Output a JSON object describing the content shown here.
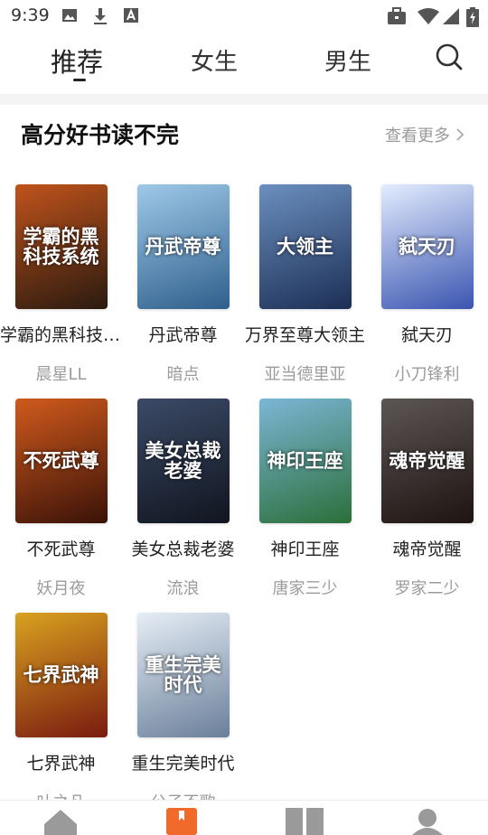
{
  "status": {
    "time": "9:39"
  },
  "tabs": [
    {
      "label": "推荐"
    },
    {
      "label": "女生"
    },
    {
      "label": "男生"
    }
  ],
  "section": {
    "title": "高分好书读不完",
    "more": "查看更多"
  },
  "books": [
    {
      "title": "学霸的黑科技系统",
      "author": "晨星LL",
      "cover_text": "学霸的黑科技系统",
      "colors": [
        "#c0531b",
        "#2a1a10"
      ]
    },
    {
      "title": "丹武帝尊",
      "author": "暗点",
      "cover_text": "丹武帝尊",
      "colors": [
        "#9ec9e8",
        "#2f5f8c"
      ]
    },
    {
      "title": "万界至尊大领主",
      "author": "亚当德里亚",
      "cover_text": "大领主",
      "colors": [
        "#6b8fbf",
        "#1c2f55"
      ]
    },
    {
      "title": "弑天刃",
      "author": "小刀锋利",
      "cover_text": "弑天刃",
      "colors": [
        "#e3ecff",
        "#3a55b0"
      ]
    },
    {
      "title": "不死武尊",
      "author": "妖月夜",
      "cover_text": "不死武尊",
      "colors": [
        "#d05a1c",
        "#3a1208"
      ]
    },
    {
      "title": "美女总裁老婆",
      "author": "流浪",
      "cover_text": "美女总裁老婆",
      "colors": [
        "#3b4a66",
        "#10151f"
      ]
    },
    {
      "title": "神印王座",
      "author": "唐家三少",
      "cover_text": "神印王座",
      "colors": [
        "#7bb6d6",
        "#2b6f3a"
      ]
    },
    {
      "title": "魂帝觉醒",
      "author": "罗家二少",
      "cover_text": "魂帝觉醒",
      "colors": [
        "#5c5655",
        "#1e1412"
      ]
    },
    {
      "title": "七界武神",
      "author": "叶之凡",
      "cover_text": "七界武神",
      "colors": [
        "#d9a21f",
        "#7a1a10"
      ]
    },
    {
      "title": "重生完美时代",
      "author": "公子不歌",
      "cover_text": "重生完美时代",
      "colors": [
        "#e6eef6",
        "#6a7f9a"
      ]
    }
  ]
}
